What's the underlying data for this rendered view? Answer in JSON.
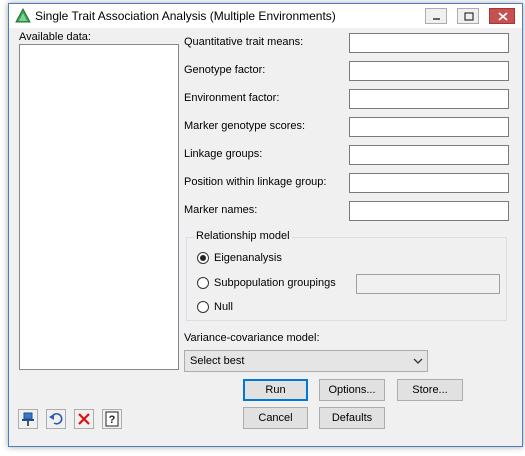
{
  "window": {
    "title": "Single Trait Association Analysis (Multiple Environments)"
  },
  "available_data_label": "Available data:",
  "fields": [
    {
      "label": "Quantitative trait means:",
      "value": ""
    },
    {
      "label": "Genotype factor:",
      "value": ""
    },
    {
      "label": "Environment factor:",
      "value": ""
    },
    {
      "label": "Marker genotype scores:",
      "value": ""
    },
    {
      "label": "Linkage groups:",
      "value": ""
    },
    {
      "label": "Position within linkage group:",
      "value": ""
    },
    {
      "label": "Marker names:",
      "value": ""
    }
  ],
  "relationship_model": {
    "title": "Relationship model",
    "options": [
      "Eigenanalysis",
      "Subpopulation groupings",
      "Null"
    ],
    "selected": "Eigenanalysis",
    "subpopulation_value": ""
  },
  "variance_model": {
    "label": "Variance-covariance model:",
    "selected": "Select best"
  },
  "buttons": {
    "run": "Run",
    "options": "Options...",
    "store": "Store...",
    "cancel": "Cancel",
    "defaults": "Defaults"
  },
  "icons": {
    "app": "genstat-triangle-icon",
    "toolbar": [
      "pin-icon",
      "undo-icon",
      "clear-icon",
      "help-icon"
    ]
  },
  "colors": {
    "accent": "#0078d7",
    "close_button": "#c75050"
  }
}
